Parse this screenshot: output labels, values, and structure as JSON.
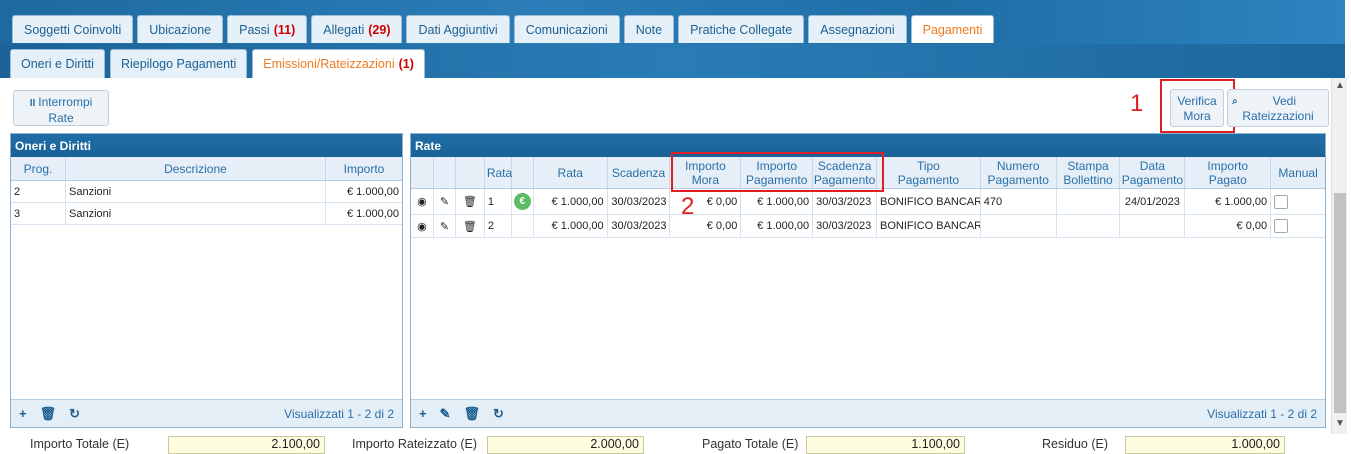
{
  "tabs_top": [
    {
      "label": "Soggetti Coinvolti"
    },
    {
      "label": "Ubicazione"
    },
    {
      "label": "Passi",
      "count": "(11)"
    },
    {
      "label": "Allegati",
      "count": "(29)"
    },
    {
      "label": "Dati Aggiuntivi"
    },
    {
      "label": "Comunicazioni"
    },
    {
      "label": "Note"
    },
    {
      "label": "Pratiche Collegate"
    },
    {
      "label": "Assegnazioni"
    },
    {
      "label": "Pagamenti",
      "active": true
    }
  ],
  "tabs_sub": [
    {
      "label": "Oneri e Diritti"
    },
    {
      "label": "Riepilogo Pagamenti"
    },
    {
      "label": "Emissioni/Rateizzazioni",
      "count": "(1)",
      "active": true
    }
  ],
  "toolbar": {
    "interrompi_line1": "Interrompi",
    "interrompi_line2": "Rate",
    "verifica_line1": "Verifica",
    "verifica_line2": "Mora",
    "vedi_line1": "Vedi",
    "vedi_line2": "Rateizzazioni",
    "annotation_1": "1",
    "annotation_2": "2"
  },
  "oneri": {
    "title": "Oneri e Diritti",
    "columns": [
      "Prog.",
      "Descrizione",
      "Importo"
    ],
    "rows": [
      {
        "prog": "2",
        "descrizione": "Sanzioni",
        "importo": "€ 1.000,00"
      },
      {
        "prog": "3",
        "descrizione": "Sanzioni",
        "importo": "€ 1.000,00"
      }
    ],
    "footer": "Visualizzati 1 - 2 di 2"
  },
  "rate": {
    "title": "Rate",
    "columns": [
      "Rata",
      "Rata",
      "Scadenza",
      "Importo Mora",
      "Importo Pagamento",
      "Scadenza Pagamento",
      "Tipo Pagamento",
      "Numero Pagamento",
      "Stampa Bollettino",
      "Data Pagamento",
      "Importo Pagato",
      "Manual"
    ],
    "col_rata_short": "Rata",
    "col_rata": "Rata",
    "col_scadenza": "Scadenza",
    "col_importo_mora_1": "Importo",
    "col_importo_mora_2": "Mora",
    "col_importo_pag_1": "Importo",
    "col_importo_pag_2": "Pagamento",
    "col_scad_pag_1": "Scadenza",
    "col_scad_pag_2": "Pagamento",
    "col_tipo_1": "Tipo",
    "col_tipo_2": "Pagamento",
    "col_numero_1": "Numero",
    "col_numero_2": "Pagamento",
    "col_stampa_1": "Stampa",
    "col_stampa_2": "Bollettino",
    "col_data_1": "Data",
    "col_data_2": "Pagamento",
    "col_pagato_1": "Importo",
    "col_pagato_2": "Pagato",
    "col_manual": "Manual",
    "rows": [
      {
        "n": "1",
        "rata": "€ 1.000,00",
        "scadenza": "30/03/2023",
        "mora": "€ 0,00",
        "importo_pag": "€ 1.000,00",
        "scad_pag": "30/03/2023",
        "tipo": "BONIFICO BANCARIO",
        "numero": "470",
        "stampa": "",
        "data_pag": "24/01/2023",
        "pagato": "€ 1.000,00",
        "paid_badge": "€"
      },
      {
        "n": "2",
        "rata": "€ 1.000,00",
        "scadenza": "30/03/2023",
        "mora": "€ 0,00",
        "importo_pag": "€ 1.000,00",
        "scad_pag": "30/03/2023",
        "tipo": "BONIFICO BANCARIO",
        "numero": "",
        "stampa": "",
        "data_pag": "",
        "pagato": "€ 0,00",
        "paid_badge": ""
      }
    ],
    "footer": "Visualizzati 1 - 2 di 2"
  },
  "totals": {
    "importo_totale_label": "Importo Totale (E)",
    "importo_totale": "2.100,00",
    "importo_rateizzato_label": "Importo Rateizzato (E)",
    "importo_rateizzato": "2.000,00",
    "pagato_totale_label": "Pagato Totale (E)",
    "pagato_totale": "1.100,00",
    "residuo_label": "Residuo (E)",
    "residuo": "1.000,00"
  },
  "colors": {
    "accent": "#1f6ea6",
    "active_tab": "#f07a1f",
    "count": "#d00000",
    "annotation": "#e02020"
  }
}
